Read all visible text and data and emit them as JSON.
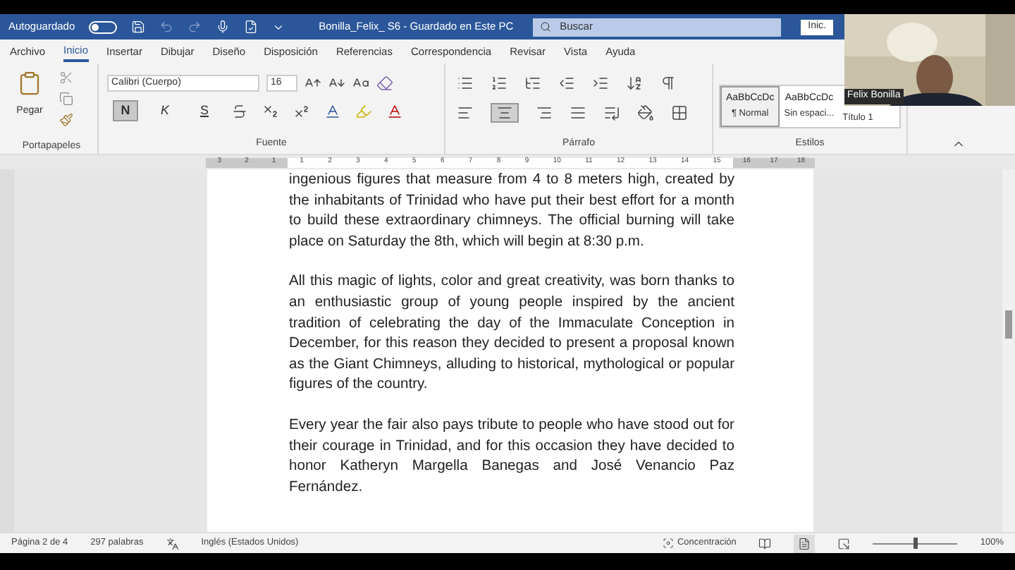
{
  "title_bar": {
    "autosave_label": "Autoguardado",
    "autosave_on": false,
    "document_title": "Bonilla_Felix_ S6  -  Guardado en Este PC",
    "search": {
      "placeholder": "Buscar"
    },
    "account_button": "Inic."
  },
  "tabs": [
    {
      "label": "Archivo",
      "selected": false
    },
    {
      "label": "Inicio",
      "selected": true
    },
    {
      "label": "Insertar",
      "selected": false
    },
    {
      "label": "Dibujar",
      "selected": false
    },
    {
      "label": "Diseño",
      "selected": false
    },
    {
      "label": "Disposición",
      "selected": false
    },
    {
      "label": "Referencias",
      "selected": false
    },
    {
      "label": "Correspondencia",
      "selected": false
    },
    {
      "label": "Revisar",
      "selected": false
    },
    {
      "label": "Vista",
      "selected": false
    },
    {
      "label": "Ayuda",
      "selected": false
    }
  ],
  "ribbon": {
    "clipboard": {
      "paste_label": "Pegar",
      "group_label": "Portapapeles"
    },
    "font": {
      "font_name": "Calibri (Cuerpo)",
      "font_size": "16",
      "bold": {
        "label": "N",
        "selected": true
      },
      "italic": {
        "label": "K",
        "selected": false
      },
      "underline": {
        "label": "S",
        "selected": false
      },
      "group_label": "Fuente"
    },
    "paragraph": {
      "group_label": "Párrafo"
    },
    "styles": {
      "items": [
        {
          "preview": "AaBbCcDc",
          "name": "¶ Normal",
          "selected": true
        },
        {
          "preview": "AaBbCcDc",
          "name": "Sin espaci...",
          "selected": false
        },
        {
          "name": "Título 1",
          "selected": false
        }
      ],
      "group_label": "Estilos"
    }
  },
  "ruler": {
    "left_numbers": [
      "3",
      "2",
      "1"
    ],
    "numbers": [
      "1",
      "2",
      "3",
      "4",
      "5",
      "6",
      "7",
      "8",
      "9",
      "10",
      "11",
      "12",
      "13",
      "14",
      "15"
    ],
    "right_numbers": [
      "16",
      "17",
      "18"
    ]
  },
  "document": {
    "paragraphs": [
      "ingenious figures that measure from 4 to 8 meters high, created by the inhabitants of Trinidad who have put their best effort for a month to build these extraordinary chimneys. The official burning will take place on Saturday the 8th, which will begin at 8:30 p.m.",
      "All this magic of lights, color and great creativity, was born thanks to an enthusiastic group of young people inspired by the ancient tradition of celebrating the day of the Immaculate Conception in December, for this reason they decided to present a proposal known as the Giant Chimneys, alluding to historical, mythological or popular figures of the country.",
      "Every year the fair also pays tribute to people who have stood out for their courage in Trinidad, and for this occasion they have decided to honor Katheryn Margella Banegas and José Venancio Paz Fernández."
    ]
  },
  "status_bar": {
    "page": "Página 2 de 4",
    "words": "297 palabras",
    "language": "Inglés (Estados Unidos)",
    "focus": "Concentración",
    "zoom_slider": {
      "level": 0.5
    },
    "zoom": "100%"
  },
  "webcam": {
    "kind": "picture",
    "name": "Felix Bonilla"
  }
}
